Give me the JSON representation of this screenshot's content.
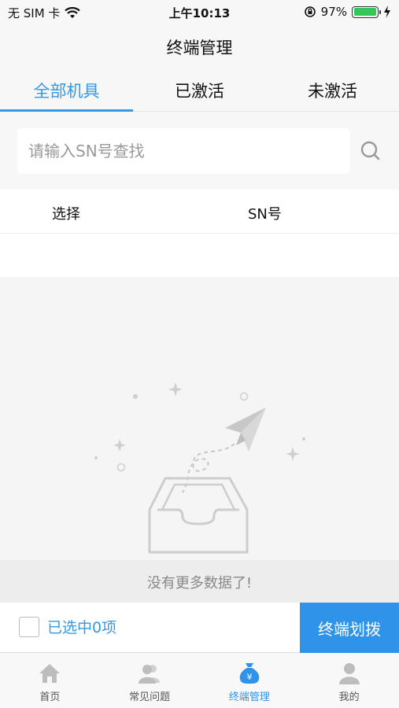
{
  "status_bar": {
    "carrier": "无 SIM 卡",
    "time": "上午10:13",
    "battery_percent": "97%",
    "battery_level": 0.97
  },
  "nav": {
    "title": "终端管理"
  },
  "tabs": [
    {
      "label": "全部机具",
      "active": true
    },
    {
      "label": "已激活",
      "active": false
    },
    {
      "label": "未激活",
      "active": false
    }
  ],
  "search": {
    "placeholder": "请输入SN号查找",
    "value": ""
  },
  "table": {
    "columns": [
      "选择",
      "SN号"
    ]
  },
  "empty": {
    "message": "没有更多数据了!"
  },
  "action_bar": {
    "selected_label": "已选中0项",
    "transfer_button": "终端划拨"
  },
  "tab_bar": [
    {
      "label": "首页",
      "icon": "home-icon"
    },
    {
      "label": "常见问题",
      "icon": "users-icon"
    },
    {
      "label": "终端管理",
      "icon": "money-bag-icon",
      "active": true
    },
    {
      "label": "我的",
      "icon": "person-icon"
    }
  ],
  "colors": {
    "accent": "#3498e6",
    "button": "#2f93ea"
  }
}
